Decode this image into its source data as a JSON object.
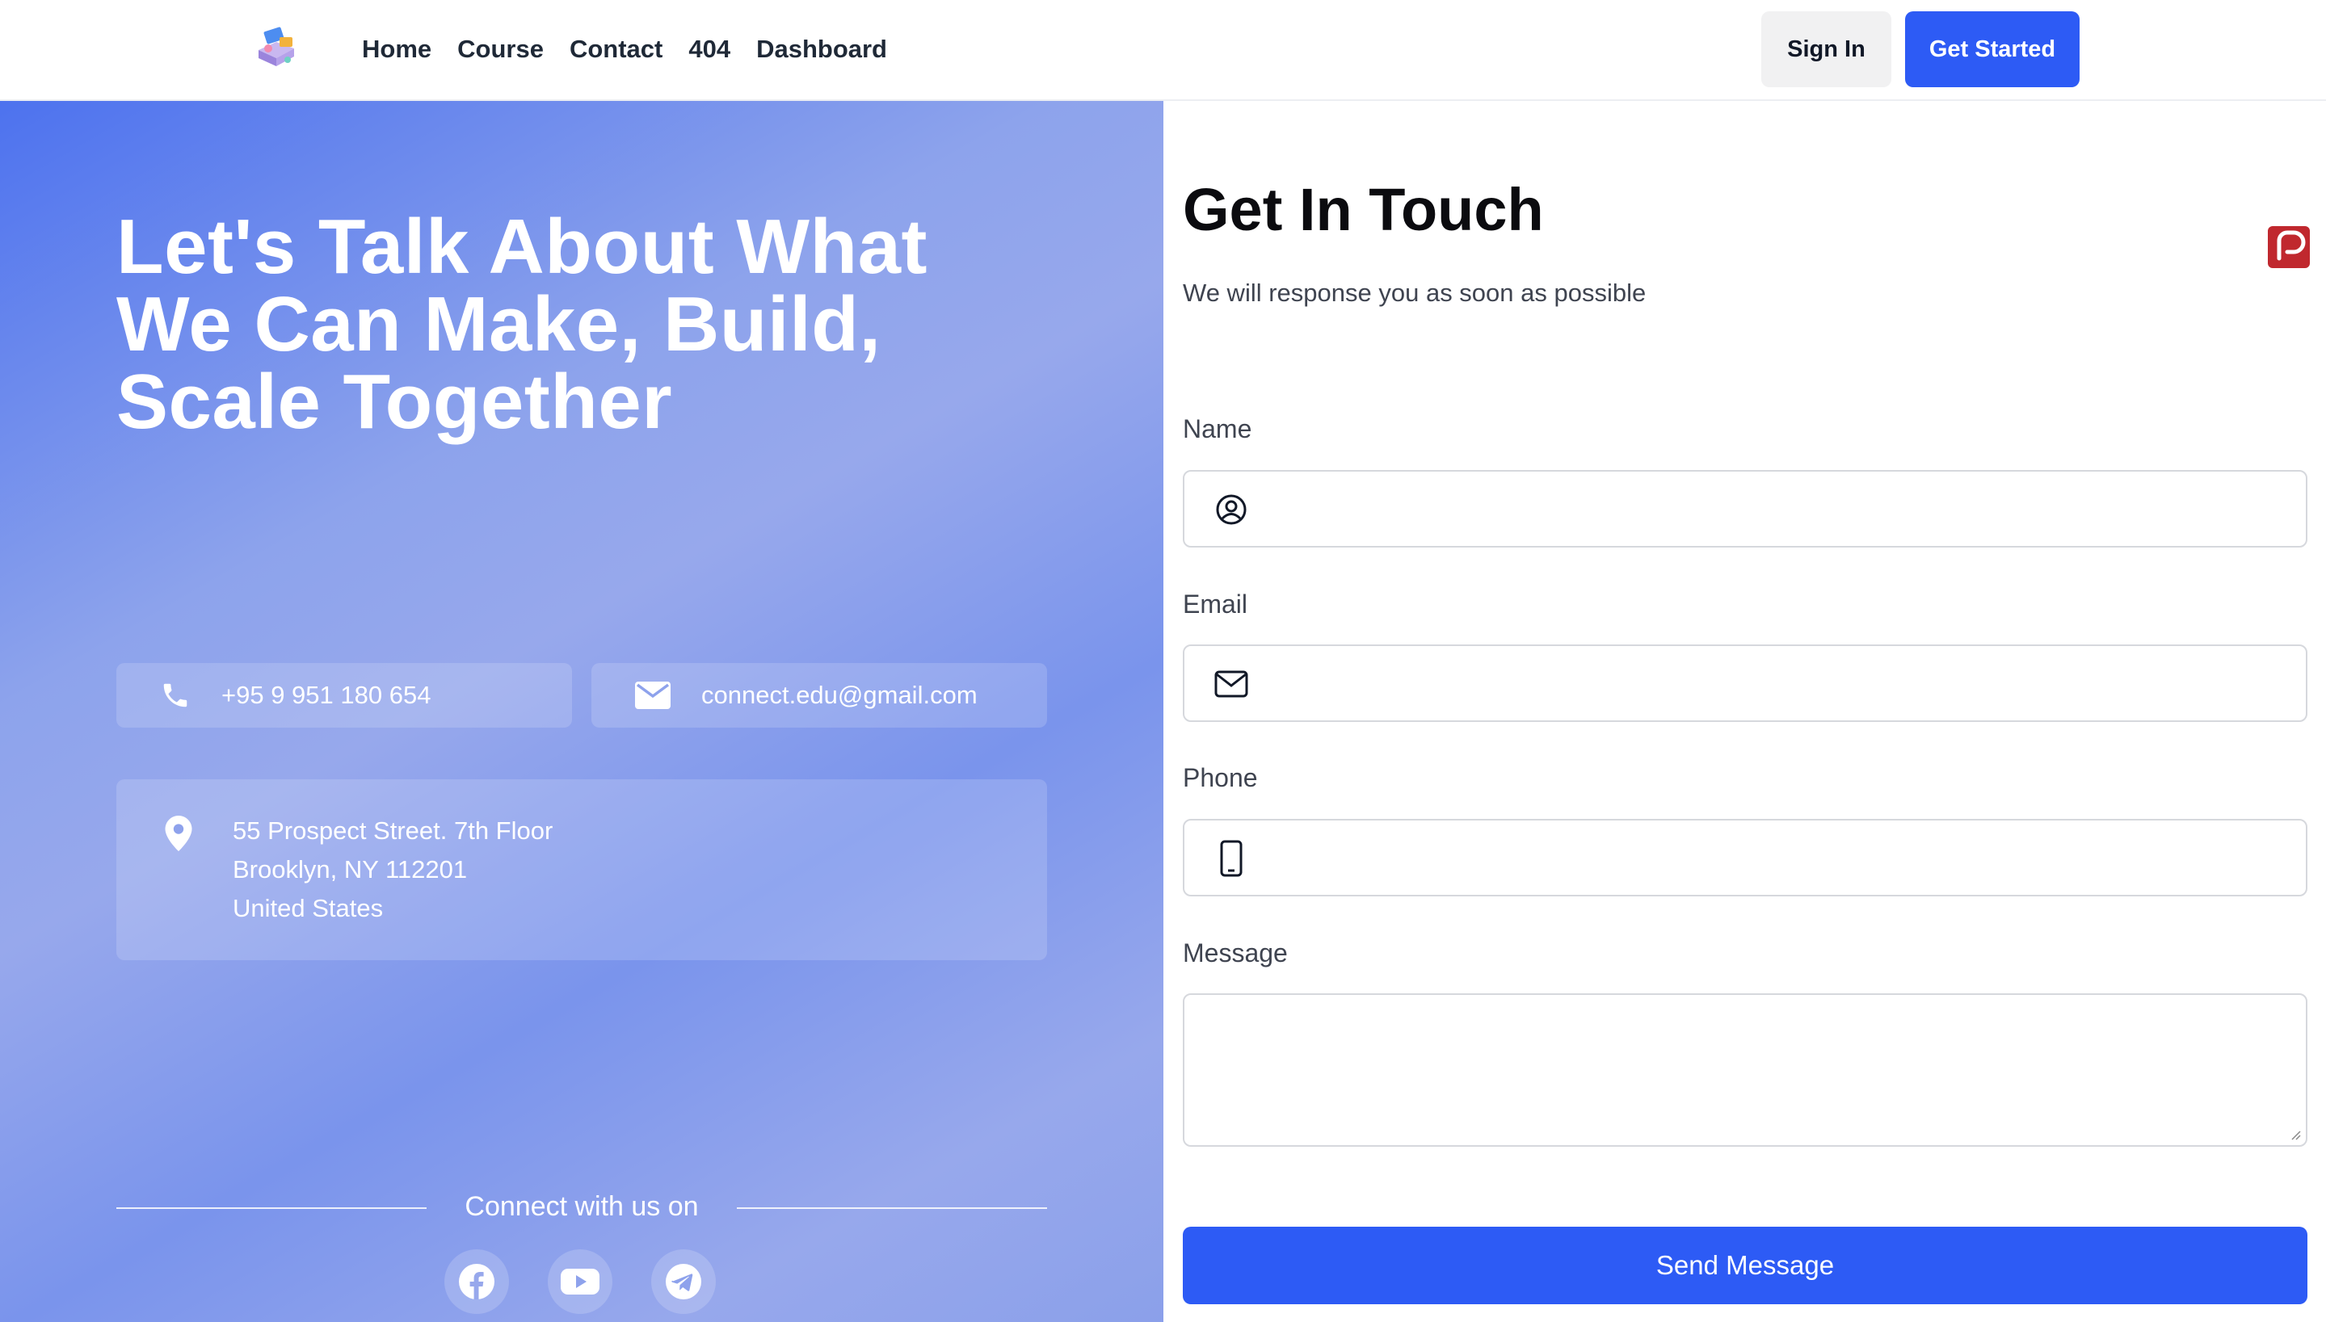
{
  "header": {
    "logo_name": "site-logo",
    "nav": [
      "Home",
      "Course",
      "Contact",
      "404",
      "Dashboard"
    ],
    "sign_in_label": "Sign In",
    "get_started_label": "Get Started",
    "accent_color": "#2d5bf5"
  },
  "hero": {
    "title_lines": [
      "Let's Talk About What",
      "We Can Make, Build,",
      "Scale Together"
    ],
    "phone": "+95 9 951 180 654",
    "email": "connect.edu@gmail.com",
    "address_lines": [
      "55 Prospect Street. 7th Floor",
      "Brooklyn, NY 112201",
      "United States"
    ],
    "connect_text": "Connect with us on",
    "socials": [
      "facebook-icon",
      "youtube-icon",
      "telegram-icon"
    ]
  },
  "form": {
    "title": "Get In Touch",
    "subtitle": "We will response you as soon as possible",
    "name_label": "Name",
    "name_value": "",
    "email_label": "Email",
    "email_value": "",
    "phone_label": "Phone",
    "phone_value": "",
    "message_label": "Message",
    "message_value": "",
    "send_label": "Send Message"
  }
}
